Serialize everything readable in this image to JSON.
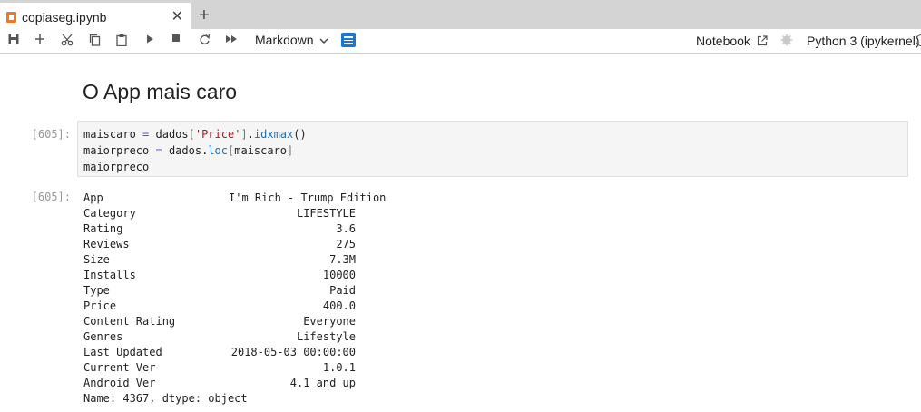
{
  "tab": {
    "title": "copiaseg.ipynb",
    "close": "✕",
    "new_tab": "+"
  },
  "toolbar": {
    "cell_type": "Markdown",
    "notebook_link": "Notebook",
    "kernel": "Python 3 (ipykernel)"
  },
  "cells": {
    "heading": "O App mais caro",
    "input_prompt": "[605]:",
    "output_prompt": "[605]:",
    "code_lines": [
      "maiscaro = dados['Price'].idxmax()",
      "maiorpreco = dados.loc[maiscaro]",
      "maiorpreco"
    ],
    "output_rows": [
      {
        "key": "App",
        "value": "I'm Rich - Trump Edition"
      },
      {
        "key": "Category",
        "value": "LIFESTYLE"
      },
      {
        "key": "Rating",
        "value": "3.6"
      },
      {
        "key": "Reviews",
        "value": "275"
      },
      {
        "key": "Size",
        "value": "7.3M"
      },
      {
        "key": "Installs",
        "value": "10000"
      },
      {
        "key": "Type",
        "value": "Paid"
      },
      {
        "key": "Price",
        "value": "400.0"
      },
      {
        "key": "Content Rating",
        "value": "Everyone"
      },
      {
        "key": "Genres",
        "value": "Lifestyle"
      },
      {
        "key": "Last Updated",
        "value": "2018-05-03 00:00:00"
      },
      {
        "key": "Current Ver",
        "value": "1.0.1"
      },
      {
        "key": "Android Ver",
        "value": "4.1 and up"
      }
    ],
    "output_footer": "Name: 4367, dtype: object"
  },
  "colors": {
    "accent": "#1976d2",
    "notebook_icon": "#f37626",
    "string": "#b5121b",
    "operator": "#7c3aed"
  }
}
